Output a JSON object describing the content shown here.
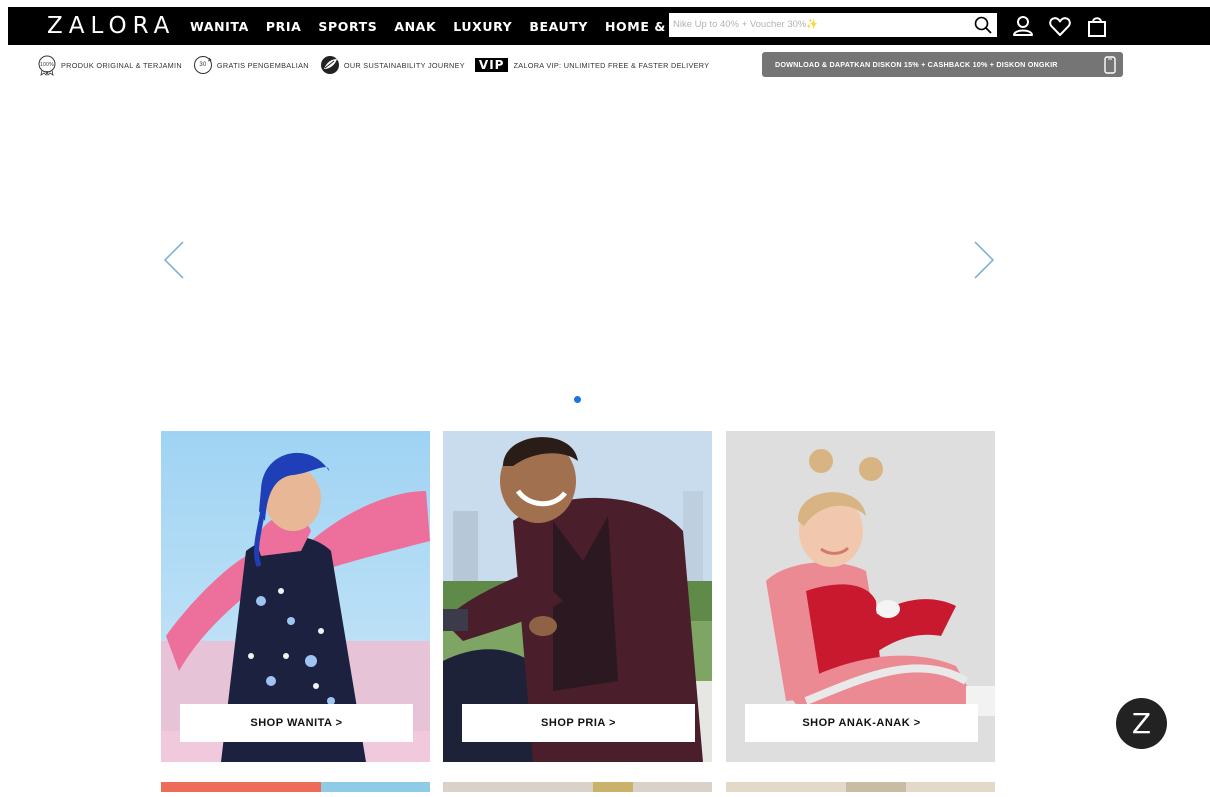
{
  "header": {
    "logo": "ZALORA",
    "nav": [
      "WANITA",
      "PRIA",
      "SPORTS",
      "ANAK",
      "LUXURY",
      "BEAUTY",
      "HOME & LIFESTYLE"
    ],
    "search": {
      "placeholder": "Nike Up to 40% + Voucher 30%✨"
    },
    "icons": [
      "search-icon",
      "account-icon",
      "wishlist-icon",
      "bag-icon"
    ]
  },
  "usp": {
    "original": "PRODUK ORIGINAL & TERJAMIN",
    "original_badge": "100%",
    "returns": "GRATIS PENGEMBALIAN",
    "returns_badge": "30",
    "sustainability": "OUR SUSTAINABILITY JOURNEY",
    "vip_badge": "VIP",
    "vip": "ZALORA VIP: UNLIMITED FREE & FASTER DELIVERY",
    "download": "DOWNLOAD & DAPATKAN DISKON 15% + CASHBACK 10% + DISKON ONGKIR"
  },
  "carousel": {
    "slide_count": 1,
    "active_index": 0
  },
  "tiles": [
    {
      "label": "SHOP WANITA >"
    },
    {
      "label": "SHOP PRIA >"
    },
    {
      "label": "SHOP ANAK-ANAK >"
    }
  ],
  "chat": {
    "label": "Z"
  },
  "colors": {
    "nav_bg": "#000000",
    "accent_dot": "#1a73e8",
    "download_btn": "#757575",
    "arrow": "#7fb3d9"
  }
}
